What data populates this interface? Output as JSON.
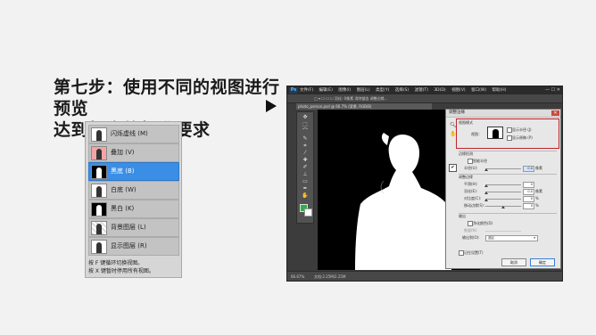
{
  "heading": {
    "line1": "第七步：使用不同的视图进行预览",
    "line2": "达到相应的标准要求"
  },
  "view_modes": {
    "items": [
      {
        "label": "闪烁虚线 (M)",
        "selected": false
      },
      {
        "label": "叠加 (V)",
        "selected": false
      },
      {
        "label": "黑底 (B)",
        "selected": true
      },
      {
        "label": "白底 (W)",
        "selected": false
      },
      {
        "label": "黑白 (K)",
        "selected": false
      },
      {
        "label": "背景图层 (L)",
        "selected": false
      },
      {
        "label": "显示图层 (R)",
        "selected": false
      }
    ],
    "note1": "按 F 键循环切换视图。",
    "note2": "按 X 键暂时停用所有视图。"
  },
  "photoshop": {
    "logo": "Ps",
    "menu": [
      "文件(F)",
      "编辑(E)",
      "图像(I)",
      "图层(L)",
      "类型(Y)",
      "选择(S)",
      "滤镜(T)",
      "3D(D)",
      "视图(V)",
      "窗口(W)",
      "帮助(H)"
    ],
    "window_buttons": "—  ☐  ✕",
    "options_text": "□ ▾   ☐ ☐ ☐   羽化: 0像素   消除锯齿   调整边缘...",
    "doc_tab": "photo_person.psd @ 66.7% (背景, RGB/8)",
    "zoom": "66.67%",
    "doc_info": "文档:2.25M/2.25M",
    "colors": {
      "foreground": "#29b34a",
      "background": "#ffffff"
    }
  },
  "dialog": {
    "title": "调整边缘",
    "close": "✕",
    "view_mode_section": "视图模式",
    "view_label": "视图：",
    "show_radius": "显示半径 (J)",
    "show_original": "显示原稿 (P)",
    "edge_detection": "边缘检测",
    "smart_radius": "智能半径",
    "radius_label": "半径(U):",
    "radius_value": "0.0",
    "radius_unit": "像素",
    "adjust_edge": "调整边缘",
    "smooth_label": "平滑(H):",
    "smooth_value": "0",
    "feather_label": "羽化(E):",
    "feather_value": "0.0",
    "feather_unit": "像素",
    "contrast_label": "对比度(C):",
    "contrast_value": "0",
    "contrast_unit": "%",
    "shift_label": "移动边缘(S):",
    "shift_value": "0",
    "shift_unit": "%",
    "output_section": "输出",
    "decontaminate": "净化颜色(D)",
    "amount_label": "数量(N):",
    "output_to_label": "输出到(O):",
    "output_to_value": "选区",
    "remember": "记住设置(T)",
    "cancel": "取消",
    "ok": "确定"
  }
}
